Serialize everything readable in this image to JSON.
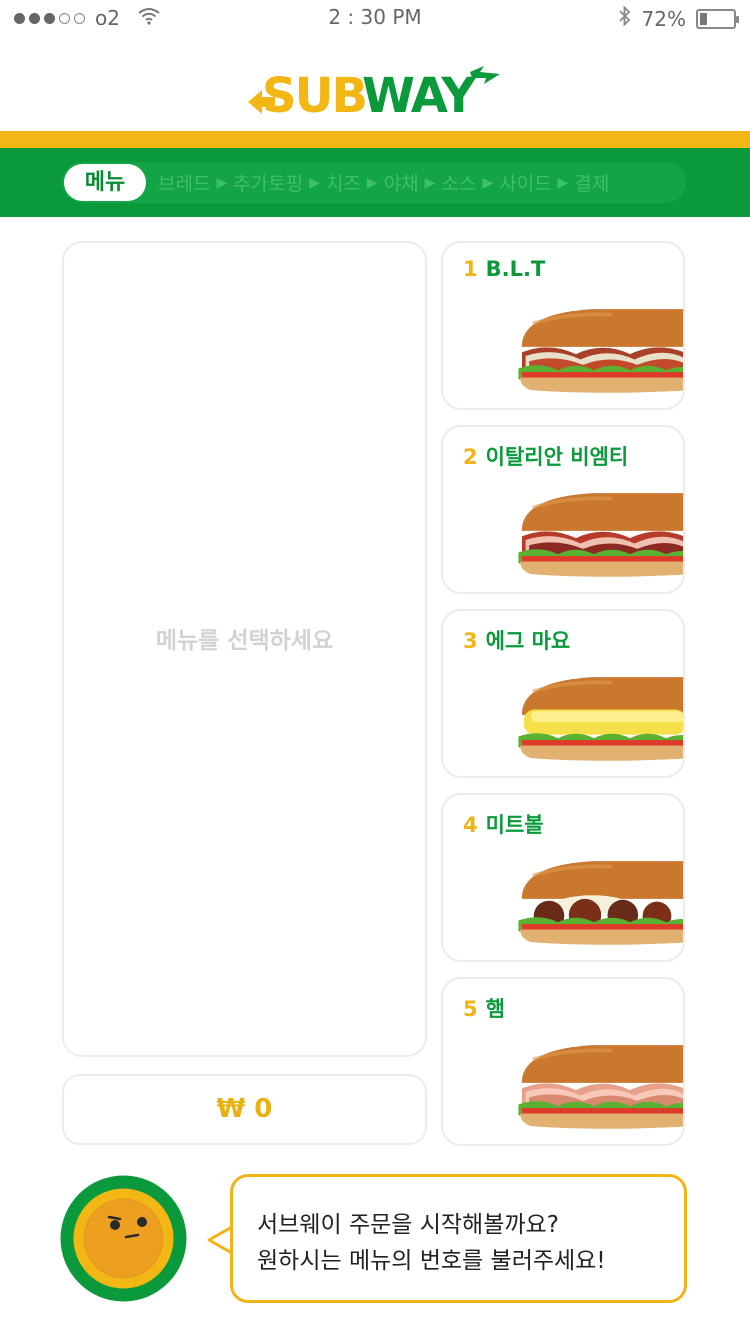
{
  "status": {
    "carrier": "o2",
    "time": "2 : 30 PM",
    "battery": "72%",
    "signal_bars_filled": 3,
    "signal_bars_total": 5
  },
  "brand": {
    "logo_text_yellow": "SUB",
    "logo_text_green": "WAY",
    "colors": {
      "green": "#0b9a3b",
      "yellow": "#f2b714"
    }
  },
  "nav": {
    "active": "메뉴",
    "steps": [
      "브레드",
      "추가토핑",
      "치즈",
      "야채",
      "소스",
      "사이드",
      "결제"
    ]
  },
  "selection": {
    "placeholder": "메뉴를 선택하세요",
    "price": "₩ 0"
  },
  "menu": [
    {
      "num": "1",
      "name": "B.L.T",
      "filling": "bacon"
    },
    {
      "num": "2",
      "name": "이탈리안 비엠티",
      "filling": "salami"
    },
    {
      "num": "3",
      "name": "에그 마요",
      "filling": "egg"
    },
    {
      "num": "4",
      "name": "미트볼",
      "filling": "meatball"
    },
    {
      "num": "5",
      "name": "햄",
      "filling": "ham"
    }
  ],
  "assistant": {
    "line1": "서브웨이 주문을 시작해볼까요?",
    "line2": "원하시는 메뉴의 번호를 불러주세요!"
  }
}
